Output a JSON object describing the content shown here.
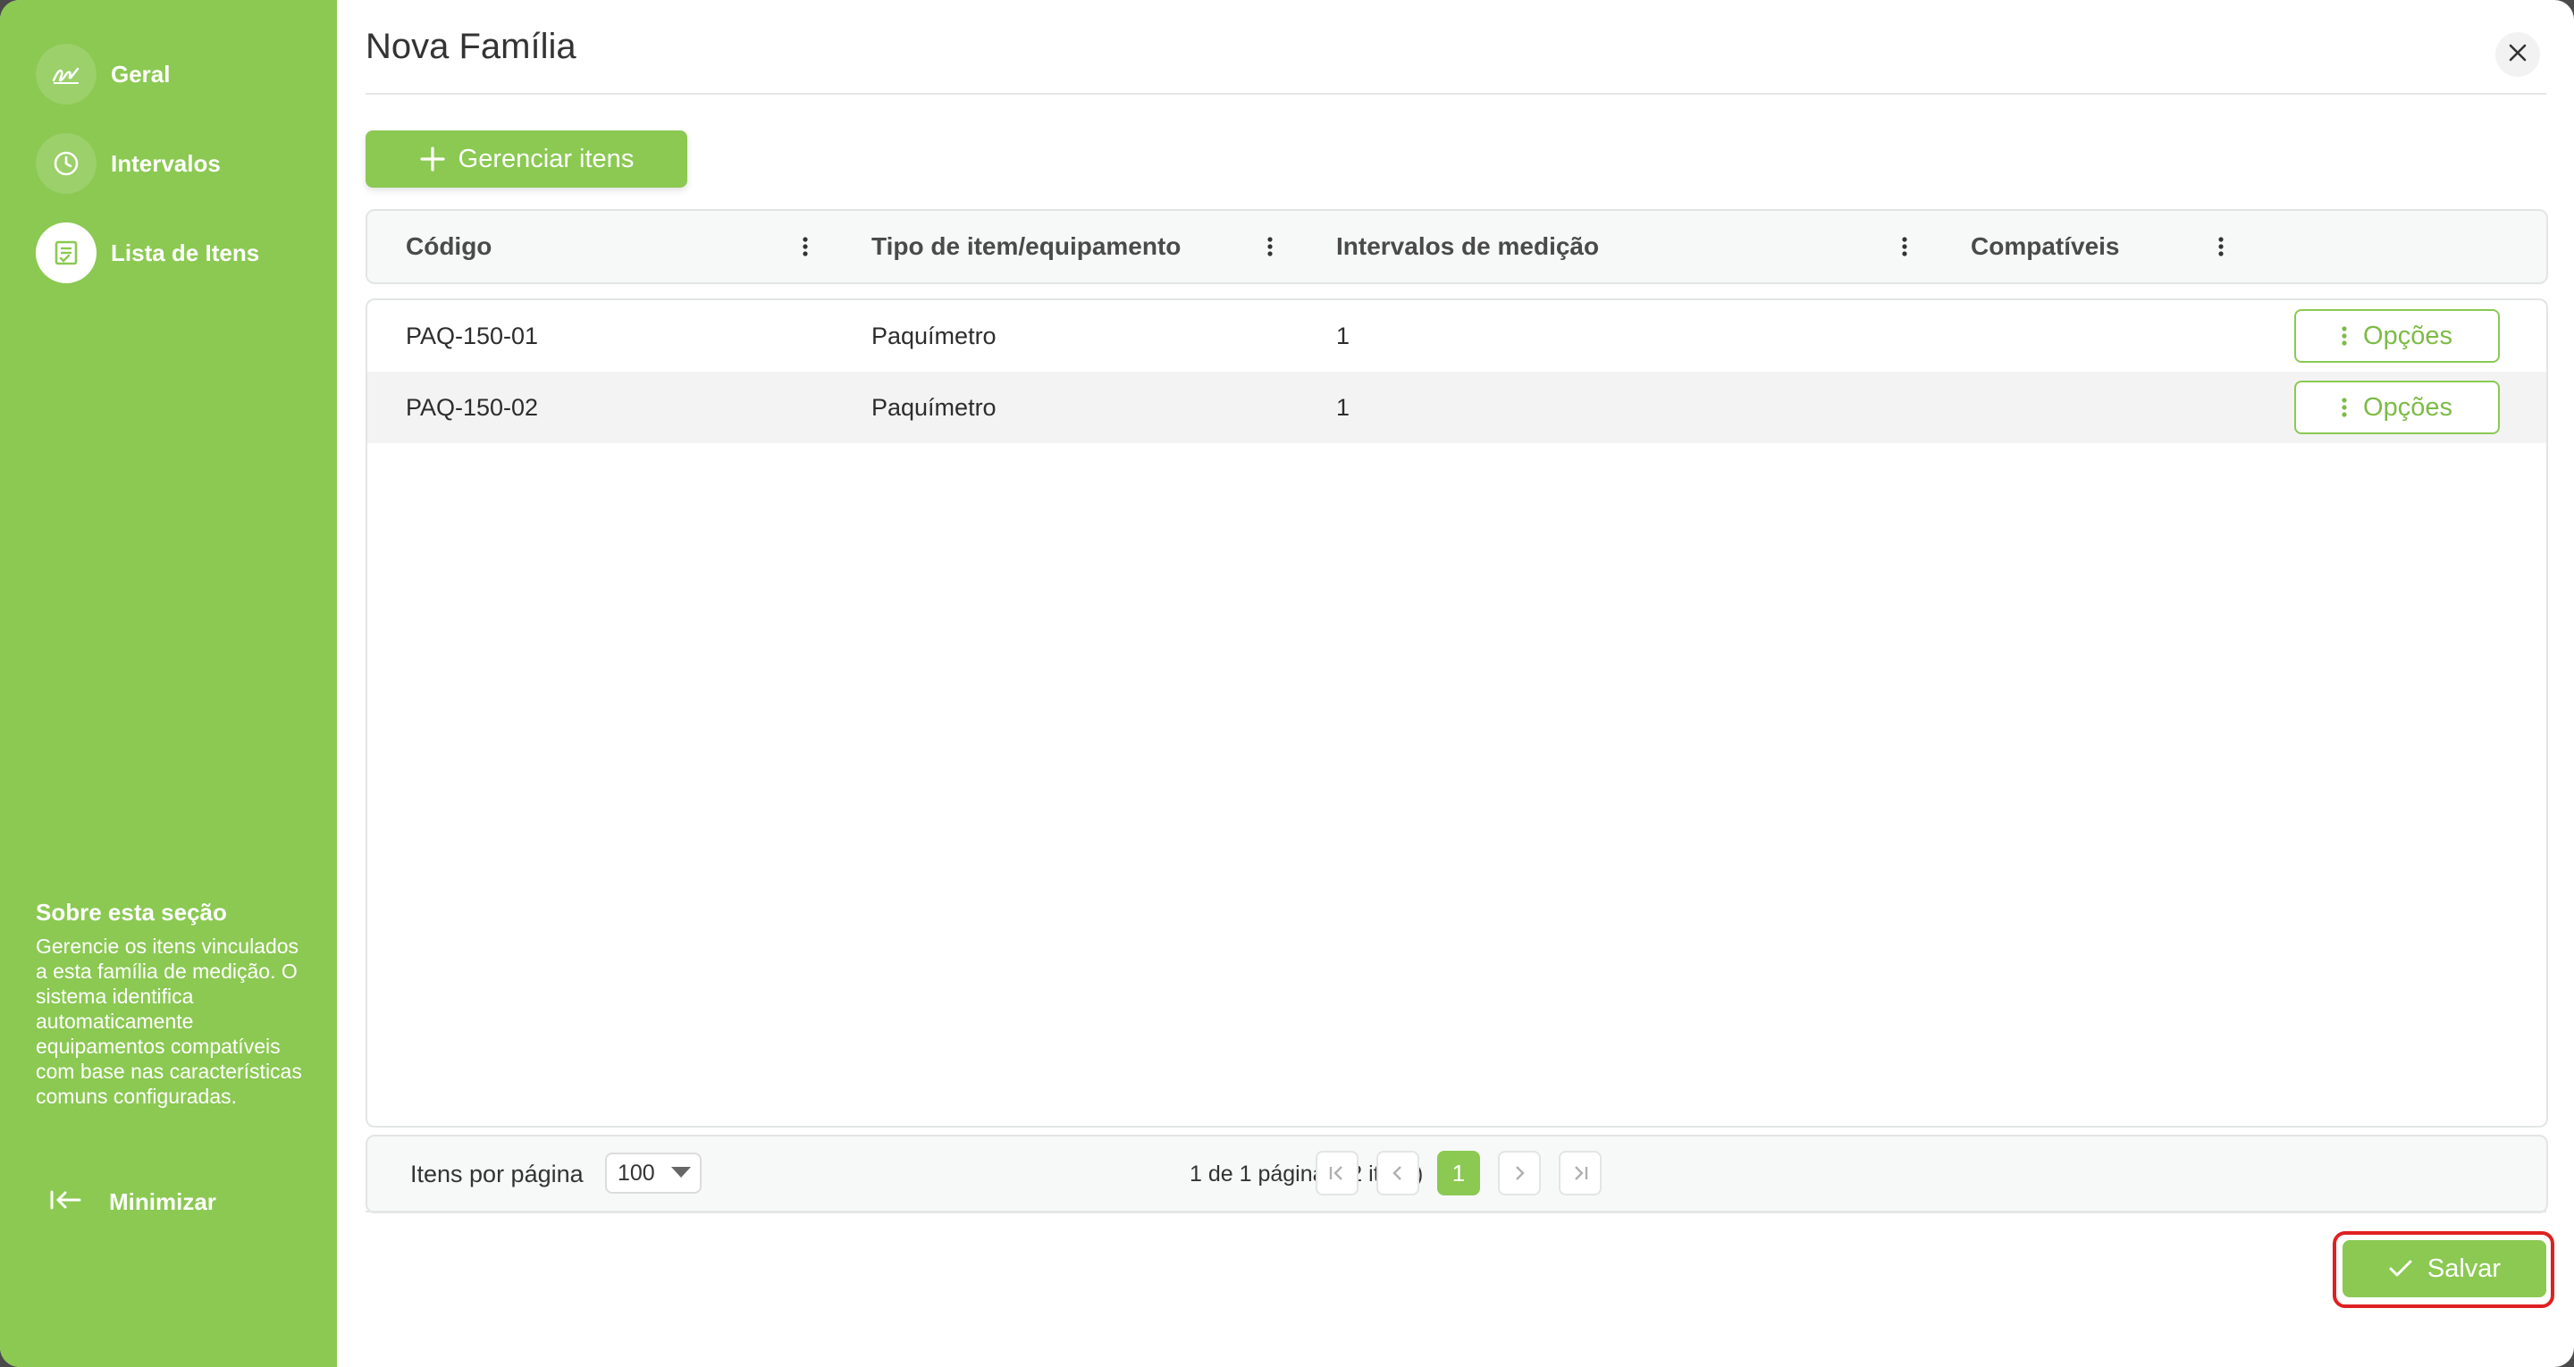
{
  "sidebar": {
    "items": [
      {
        "label": "Geral",
        "icon": "signature-icon"
      },
      {
        "label": "Intervalos",
        "icon": "clock-icon"
      },
      {
        "label": "Lista de Itens",
        "icon": "list-check-icon",
        "active": true
      }
    ],
    "about_title": "Sobre esta seção",
    "about_text": "Gerencie os itens vinculados a esta família de medição. O sistema identifica automaticamente equipamentos compatíveis com base nas características comuns configuradas.",
    "minimize_label": "Minimizar",
    "color": "#8bc952"
  },
  "dialog": {
    "title": "Nova Família",
    "close_icon": "close-icon"
  },
  "toolbar": {
    "manage_label": "Gerenciar itens"
  },
  "table": {
    "columns": [
      "Código",
      "Tipo de item/equipamento",
      "Intervalos de medição",
      "Compatíveis"
    ],
    "rows": [
      {
        "codigo": "PAQ-150-01",
        "tipo": "Paquímetro",
        "intervalos": "1",
        "compativeis": "",
        "action": "Opções"
      },
      {
        "codigo": "PAQ-150-02",
        "tipo": "Paquímetro",
        "intervalos": "1",
        "compativeis": "",
        "action": "Opções"
      }
    ]
  },
  "pagination": {
    "per_page_label": "Itens por página",
    "per_page_value": "100",
    "info": "1 de 1 páginas (2 itens)",
    "current_page": "1"
  },
  "footer": {
    "save_label": "Salvar"
  },
  "colors": {
    "accent": "#8bc952",
    "highlight": "#e02020"
  }
}
